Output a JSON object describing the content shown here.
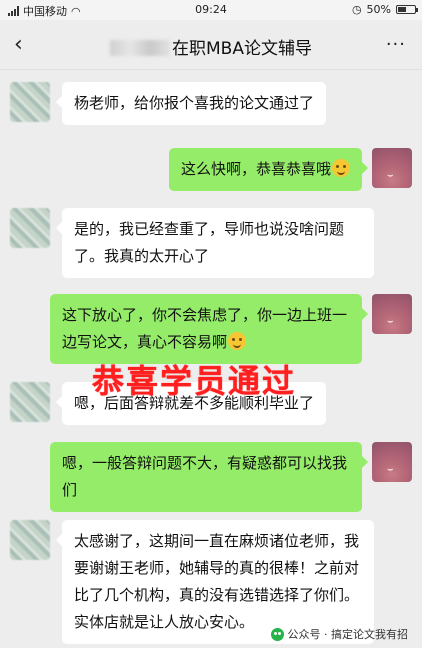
{
  "status_bar": {
    "carrier": "中国移动",
    "time": "09:24",
    "battery": "50%",
    "battery_level": 0.5
  },
  "header": {
    "back_icon": "‹",
    "title": "在职MBA论文辅导",
    "more_icon": "···"
  },
  "messages": [
    {
      "side": "left",
      "text": "杨老师，给你报个喜我的论文通过了"
    },
    {
      "side": "right",
      "text": "这么快啊，恭喜恭喜哦",
      "emoji": "laugh-emoji"
    },
    {
      "side": "left",
      "text": "是的，我已经查重了，导师也说没啥问题了。我真的太开心了"
    },
    {
      "side": "right",
      "text": "这下放心了，你不会焦虑了，你一边上班一边写论文，真心不容易啊",
      "emoji": "smile-emoji"
    },
    {
      "side": "left",
      "text": "嗯，后面答辩就差不多能顺利毕业了"
    },
    {
      "side": "right",
      "text": "嗯，一般答辩问题不大，有疑惑都可以找我们"
    },
    {
      "side": "left",
      "text": "太感谢了，这期间一直在麻烦诸位老师，我要谢谢王老师，她辅导的真的很棒！之前对比了几个机构，真的没有选错选择了你们。实体店就是让人放心安心。"
    }
  ],
  "overlay_text": "恭喜学员通过",
  "watermark": "公众号 · 搞定论文我有招",
  "colors": {
    "bg": "#ededed",
    "bubble_self": "#95ec69",
    "bubble_other": "#ffffff",
    "overlay": "#ff1f1f"
  }
}
